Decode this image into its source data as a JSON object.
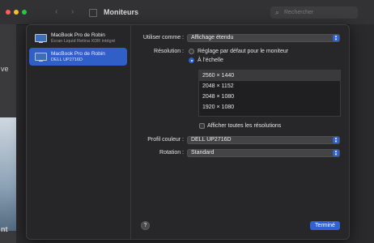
{
  "window": {
    "title": "Moniteurs",
    "search_placeholder": "Rechercher",
    "bg_fragment_1": "ve",
    "bg_fragment_2": "nt"
  },
  "sidebar": {
    "displays": [
      {
        "name": "MacBook Pro de Robin",
        "subtitle": "Écran Liquid Retina XDR intégré",
        "selected": false
      },
      {
        "name": "MacBook Pro de Robin",
        "subtitle": "DELL UP2716D",
        "selected": true
      }
    ]
  },
  "settings": {
    "use_as": {
      "label": "Utiliser comme :",
      "value": "Affichage étendu"
    },
    "resolution": {
      "label": "Résolution :",
      "options": [
        {
          "label": "Réglage par défaut pour le moniteur",
          "checked": false
        },
        {
          "label": "À l’échelle",
          "checked": true
        }
      ],
      "list": [
        "2560 × 1440",
        "2048 × 1152",
        "2048 × 1080",
        "1920 × 1080"
      ],
      "selected_index": 0,
      "show_all": {
        "label": "Afficher toutes les résolutions",
        "checked": false
      }
    },
    "color_profile": {
      "label": "Profil couleur :",
      "value": "DELL UP2716D"
    },
    "rotation": {
      "label": "Rotation :",
      "value": "Standard"
    }
  },
  "footer": {
    "help": "?",
    "done": "Terminé"
  },
  "colors": {
    "accent": "#2f62d3",
    "selection": "#2f5fc7"
  }
}
